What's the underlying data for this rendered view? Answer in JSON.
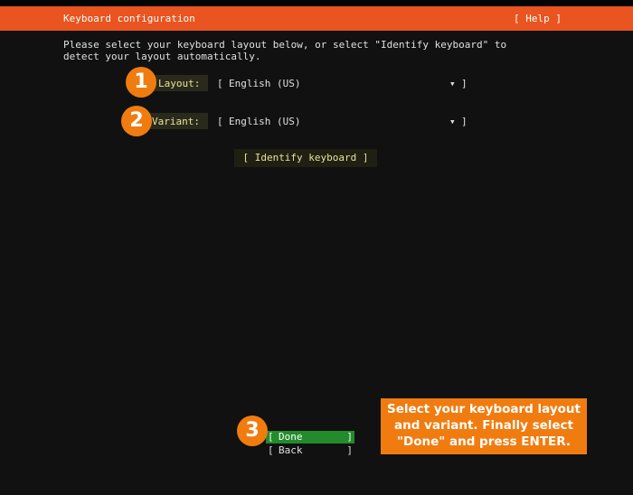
{
  "header": {
    "title": "Keyboard configuration",
    "help_label": "[ Help ]"
  },
  "intro": {
    "line1": "Please select your keyboard layout below, or select \"Identify keyboard\" to",
    "line2": "detect your layout automatically."
  },
  "layout": {
    "label": "Layout:",
    "bracket_open": "[",
    "value": "English (US)",
    "arrow": "▾",
    "bracket_close": "]"
  },
  "variant": {
    "label": "Variant:",
    "bracket_open": "[",
    "value": "English (US)",
    "arrow": "▾",
    "bracket_close": "]"
  },
  "identify_button": {
    "label": "[ Identify keyboard ]"
  },
  "done_button": {
    "open": "[",
    "label": "Done",
    "close": "]"
  },
  "back_button": {
    "open": "[",
    "label": "Back",
    "close": "]"
  },
  "badges": {
    "one": "1",
    "two": "2",
    "three": "3"
  },
  "callout": {
    "line1": "Select your keyboard layout",
    "line2": "and variant. Finally select",
    "line3": "\"Done\" and press ENTER."
  },
  "colors": {
    "header_bg": "#e95420",
    "badge_bg": "#f07c10",
    "done_bg": "#238b2b",
    "label_text": "#e8e39a"
  }
}
